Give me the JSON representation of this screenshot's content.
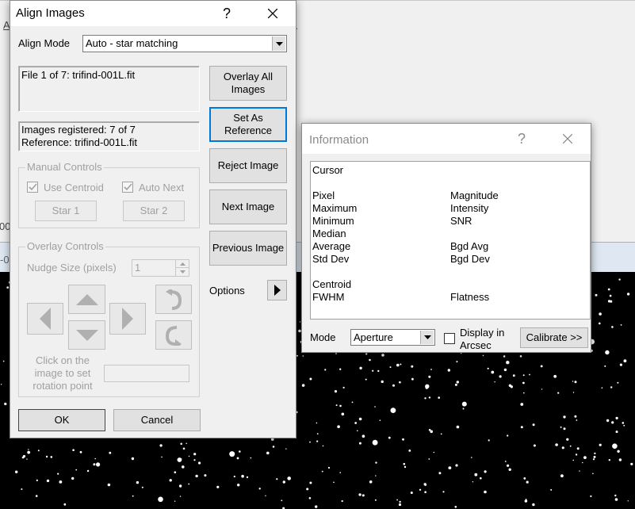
{
  "align": {
    "title": "Align Images",
    "help": "?",
    "close": "×",
    "align_mode_label": "Align Mode",
    "align_mode_value": "Auto - star matching",
    "file_info": "File 1 of 7:  trifind-001L.fit",
    "status_line1": "Images registered: 7 of 7",
    "status_line2": "Reference: trifind-001L.fit",
    "buttons": {
      "overlay_all": "Overlay All Images",
      "set_as_reference": "Set As Reference",
      "reject_image": "Reject Image",
      "next_image": "Next Image",
      "previous_image": "Previous Image",
      "options": "Options",
      "ok": "OK",
      "cancel": "Cancel"
    },
    "manual_controls": {
      "label": "Manual Controls",
      "use_centroid": "Use Centroid",
      "auto_next": "Auto Next",
      "use_centroid_checked": true,
      "auto_next_checked": true,
      "star1": "Star 1",
      "star2": "Star 2"
    },
    "overlay_controls": {
      "label": "Overlay Controls",
      "nudge_label": "Nudge Size (pixels)",
      "nudge_value": "1",
      "click_hint": "Click on the image to set rotation point"
    }
  },
  "info": {
    "title": "Information",
    "help": "?",
    "close": "×",
    "cursor": "Cursor",
    "left_col": [
      "Pixel",
      "Maximum",
      "Minimum",
      "Median",
      "Average",
      "Std Dev"
    ],
    "right_col": [
      "Magnitude",
      "Intensity",
      "SNR",
      "",
      "Bgd Avg",
      "Bgd Dev"
    ],
    "centroid": "Centroid",
    "fwhm": "FWHM",
    "flatness": "Flatness",
    "mode_label": "Mode",
    "mode_value": "Aperture",
    "display_arcsec": "Display in Arcsec",
    "display_arcsec_checked": false,
    "calibrate": "Calibrate >>"
  },
  "background": {
    "menu_fragment": "A",
    "side_fragment": "00",
    "tab_fragment": "-0",
    "image_description": "starfield"
  },
  "colors": {
    "focus_border": "#0078d7",
    "disabled_text": "#a0a0a0",
    "dialog_bg": "#f0f0f0"
  }
}
